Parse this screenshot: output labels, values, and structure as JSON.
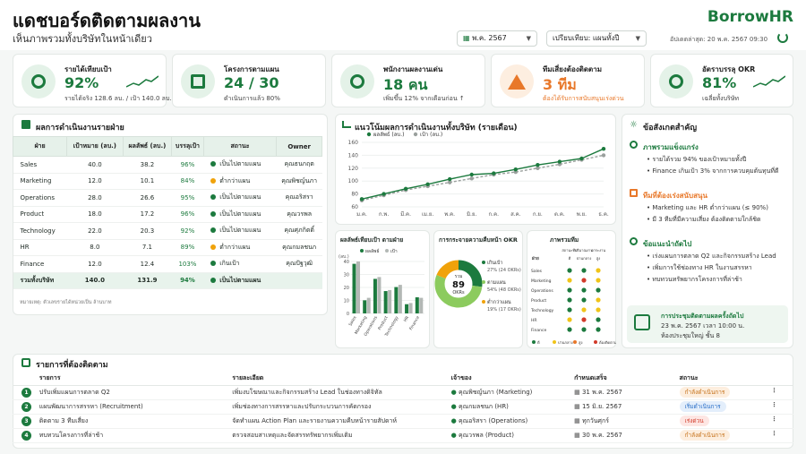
{
  "header": {
    "title": "แดชบอร์ดติดตามผลงาน",
    "subtitle": "เห็นภาพรวมทั้งบริษัทในหน้าเดียว",
    "brand": "BorrowHR",
    "period": "พ.ค. 2567",
    "compare": "เปรียบเทียบ: แผนทั้งปี",
    "updated": "อัปเดตล่าสุด: 20 พ.ค. 2567 09:30"
  },
  "kpis": [
    {
      "title": "รายได้เทียบเป้า",
      "value": "92%",
      "sub": "รายได้จริง 128.6 ลบ. / เป้า 140.0 ลบ.",
      "icon": "target-icon",
      "color": "#1c7a3e",
      "bg": "#e4f2e8"
    },
    {
      "title": "โครงการตามแผน",
      "value": "24 / 30",
      "sub": "ดำเนินการแล้ว 80%",
      "icon": "clipboard-icon",
      "color": "#1c7a3e",
      "bg": "#e4f2e8"
    },
    {
      "title": "พนักงานผลงานเด่น",
      "value": "18 คน",
      "sub": "เพิ่มขึ้น 12% จากเดือนก่อน ↑",
      "icon": "people-icon",
      "color": "#1c7a3e",
      "bg": "#e4f2e8"
    },
    {
      "title": "ทีมเสี่ยงต้องติดตาม",
      "value": "3 ทีม",
      "sub": "ต้องได้รับการสนับสนุนเร่งด่วน",
      "icon": "warning-icon",
      "color": "#e8782a",
      "bg": "#fdeee0"
    },
    {
      "title": "อัตราบรรลุ OKR",
      "value": "81%",
      "sub": "เฉลี่ยทั้งบริษัท",
      "icon": "target-icon",
      "color": "#1c7a3e",
      "bg": "#e4f2e8"
    }
  ],
  "perf": {
    "title": "ผลการดำเนินงานรายฝ่าย",
    "headers": [
      "ฝ่าย",
      "เป้าหมาย (ลบ.)",
      "ผลลัพธ์ (ลบ.)",
      "บรรลุเป้า",
      "สถานะ",
      "Owner"
    ],
    "rows": [
      {
        "dept": "Sales",
        "target": "40.0",
        "actual": "38.2",
        "pct": "96%",
        "status": "เป็นไปตามแผน",
        "color": "#1c7a3e",
        "owner": "คุณธนกฤต"
      },
      {
        "dept": "Marketing",
        "target": "12.0",
        "actual": "10.1",
        "pct": "84%",
        "status": "ต่ำกว่าแผน",
        "color": "#f0a20a",
        "owner": "คุณพิชญ์นภา"
      },
      {
        "dept": "Operations",
        "target": "28.0",
        "actual": "26.6",
        "pct": "95%",
        "status": "เป็นไปตามแผน",
        "color": "#1c7a3e",
        "owner": "คุณอริสรา"
      },
      {
        "dept": "Product",
        "target": "18.0",
        "actual": "17.2",
        "pct": "96%",
        "status": "เป็นไปตามแผน",
        "color": "#1c7a3e",
        "owner": "คุณวรพล"
      },
      {
        "dept": "Technology",
        "target": "22.0",
        "actual": "20.3",
        "pct": "92%",
        "status": "เป็นไปตามแผน",
        "color": "#1c7a3e",
        "owner": "คุณศุภกิตติ์"
      },
      {
        "dept": "HR",
        "target": "8.0",
        "actual": "7.1",
        "pct": "89%",
        "status": "ต่ำกว่าแผน",
        "color": "#f0a20a",
        "owner": "คุณกมลชนก"
      },
      {
        "dept": "Finance",
        "target": "12.0",
        "actual": "12.4",
        "pct": "103%",
        "status": "เกินเป้า",
        "color": "#1c7a3e",
        "owner": "คุณปัฐวุฒิ"
      }
    ],
    "total": {
      "label": "รวมทั้งบริษัท",
      "target": "140.0",
      "actual": "131.9",
      "pct": "94%",
      "status": "เป็นไปตามแผน"
    },
    "note": "หมายเหตุ: ตัวเลขรายได้หน่วยเป็น ล้านบาท"
  },
  "trend": {
    "title": "แนวโน้มผลการดำเนินงานทั้งบริษัท (รายเดือน)"
  },
  "bars": {
    "title": "ผลลัพธ์เทียบเป้า ตามฝ่าย"
  },
  "okr": {
    "title": "การกระจายความคืบหน้า OKR",
    "center_label": "รวม",
    "center_value": "89",
    "center_unit": "OKRs",
    "items": [
      {
        "label": "เกินเป้า",
        "value": "27% (24 OKRs)"
      },
      {
        "label": "ตามแผน",
        "value": "54% (48 OKRs)"
      },
      {
        "label": "ต่ำกว่าแผน",
        "value": "19% (17 OKRs)"
      }
    ]
  },
  "heat": {
    "title": "ภาพรวมทีม",
    "cols": [
      "ฝ่าย",
      "สถานะทีม",
      "ปริมาณงาน",
      "ภาระงาน"
    ],
    "cols_short": [
      "ดี",
      "ปานกลาง",
      "สูง"
    ],
    "rows": [
      "Sales",
      "Marketing",
      "Operations",
      "Product",
      "Technology",
      "HR",
      "Finance"
    ],
    "legend": [
      "ดี",
      "ปานกลาง",
      "สูง",
      "ต้องติดตาม"
    ]
  },
  "insights": {
    "title": "ข้อสังเกตสำคัญ",
    "sections": [
      {
        "head": "ภาพรวมแข็งแกร่ง",
        "color": "#1c7a3e",
        "items": [
          "รายได้รวม 94% ของเป้าหมายทั้งปี",
          "Finance เกินเป้า 3% จากการควบคุมต้นทุนที่ดี"
        ]
      },
      {
        "head": "ทีมที่ต้องเร่งสนับสนุน",
        "color": "#e8782a",
        "items": [
          "Marketing และ HR ต่ำกว่าแผน (≤ 90%)",
          "มี 3 ทีมที่มีความเสี่ยง ต้องติดตามใกล้ชิด"
        ]
      },
      {
        "head": "ข้อแนะนำถัดไป",
        "color": "#1c7a3e",
        "items": [
          "เร่งแผนการตลาด Q2 และกิจกรรมสร้าง Lead",
          "เพิ่มการใช้ช่องทาง HR ในงานสรรหา",
          "ทบทวนทรัพยากรโครงการที่ล่าช้า"
        ]
      }
    ],
    "meeting": {
      "title": "การประชุมติดตามผลครั้งถัดไป",
      "when": "23 พ.ค. 2567 เวลา 10:00 น.",
      "where": "ห้องประชุมใหญ่ ชั้น 8"
    }
  },
  "tasks": {
    "title": "รายการที่ต้องติดตาม",
    "headers": [
      "รายการ",
      "รายละเอียด",
      "เจ้าของ",
      "กำหนดเสร็จ",
      "สถานะ"
    ],
    "rows": [
      {
        "n": "1",
        "item": "ปรับเพิ่มแผนการตลาด Q2",
        "detail": "เพิ่มงบโฆษณาและกิจกรรมสร้าง Lead ในช่องทางดิจิทัล",
        "owner": "คุณพิชญ์นภา (Marketing)",
        "due": "31 พ.ค. 2567",
        "status": "กำลังดำเนินการ",
        "fg": "#c5711a",
        "bg": "#fdeede"
      },
      {
        "n": "2",
        "item": "แผนพัฒนาการสรรหา (Recruitment)",
        "detail": "เพิ่มช่องทางการสรรหาและปรับกระบวนการคัดกรอง",
        "owner": "คุณกมลชนก (HR)",
        "due": "15 มิ.ย. 2567",
        "status": "เริ่มดำเนินการ",
        "fg": "#2a6fc7",
        "bg": "#e3eefb"
      },
      {
        "n": "3",
        "item": "ติดตาม 3 ทีมเสี่ยง",
        "detail": "จัดทำแผน Action Plan และรายงานความคืบหน้ารายสัปดาห์",
        "owner": "คุณอริสรา (Operations)",
        "due": "ทุกวันศุกร์",
        "status": "เร่งด่วน",
        "fg": "#d23b2a",
        "bg": "#fde6e3"
      },
      {
        "n": "4",
        "item": "ทบทวนโครงการที่ล่าช้า",
        "detail": "ตรวจสอบสาเหตุและจัดสรรทรัพยากรเพิ่มเติม",
        "owner": "คุณวรพล (Product)",
        "due": "30 พ.ค. 2567",
        "status": "กำลังดำเนินการ",
        "fg": "#c5711a",
        "bg": "#fdeede"
      }
    ]
  },
  "chart_data": [
    {
      "type": "line",
      "title": "แนวโน้มผลการดำเนินงานทั้งบริษัท (รายเดือน)",
      "categories": [
        "ม.ค.",
        "ก.พ.",
        "มี.ค.",
        "เม.ย.",
        "พ.ค.",
        "มิ.ย.",
        "ก.ค.",
        "ส.ค.",
        "ก.ย.",
        "ต.ค.",
        "พ.ย.",
        "ธ.ค."
      ],
      "series": [
        {
          "name": "ผลลัพธ์ (ลบ.)",
          "color": "#1c7a3e",
          "values": [
            72,
            80,
            88,
            95,
            103,
            110,
            112,
            118,
            125,
            130,
            135,
            150
          ]
        },
        {
          "name": "เป้า (ลบ.)",
          "color": "#9aa09d",
          "values": [
            70,
            78,
            86,
            92,
            98,
            104,
            110,
            114,
            120,
            126,
            133,
            140
          ]
        }
      ],
      "yticks": [
        60,
        80,
        100,
        120,
        140,
        160
      ],
      "ylim": [
        60,
        160
      ],
      "grid": true,
      "legend": "top-left"
    },
    {
      "type": "bar",
      "title": "ผลลัพธ์เทียบเป้า ตามฝ่าย",
      "ylabel": "(ลบ.)",
      "categories": [
        "Sales",
        "Marketing",
        "Operations",
        "Product",
        "Technology",
        "HR",
        "Finance"
      ],
      "series": [
        {
          "name": "ผลลัพธ์",
          "color": "#1c7a3e",
          "values": [
            38.2,
            10.1,
            26.6,
            17.2,
            20.3,
            7.1,
            12.4
          ]
        },
        {
          "name": "เป้า",
          "color": "#b3b8b5",
          "values": [
            40.0,
            12.0,
            28.0,
            18.0,
            22.0,
            8.0,
            12.0
          ]
        }
      ],
      "yticks": [
        0,
        10,
        20,
        30,
        40
      ],
      "ylim": [
        0,
        40
      ],
      "legend": "top"
    },
    {
      "type": "pie",
      "title": "การกระจายความคืบหน้า OKR",
      "categories": [
        "เกินเป้า",
        "ตามแผน",
        "ต่ำกว่าแผน"
      ],
      "values": [
        27,
        54,
        19
      ],
      "colors": [
        "#1c7a3e",
        "#8ccb5e",
        "#f0a20a"
      ]
    },
    {
      "type": "heatmap",
      "title": "ภาพรวมทีม",
      "rows": [
        "Sales",
        "Marketing",
        "Operations",
        "Product",
        "Technology",
        "HR",
        "Finance"
      ],
      "values": [
        [
          "g",
          "g",
          "y"
        ],
        [
          "y",
          "r",
          "y"
        ],
        [
          "g",
          "g",
          "g"
        ],
        [
          "g",
          "g",
          "y"
        ],
        [
          "g",
          "y",
          "y"
        ],
        [
          "y",
          "r",
          "g"
        ],
        [
          "g",
          "g",
          "g"
        ]
      ],
      "colors": {
        "g": "#1c7a3e",
        "y": "#f0c419",
        "r": "#d23b2a"
      }
    }
  ]
}
